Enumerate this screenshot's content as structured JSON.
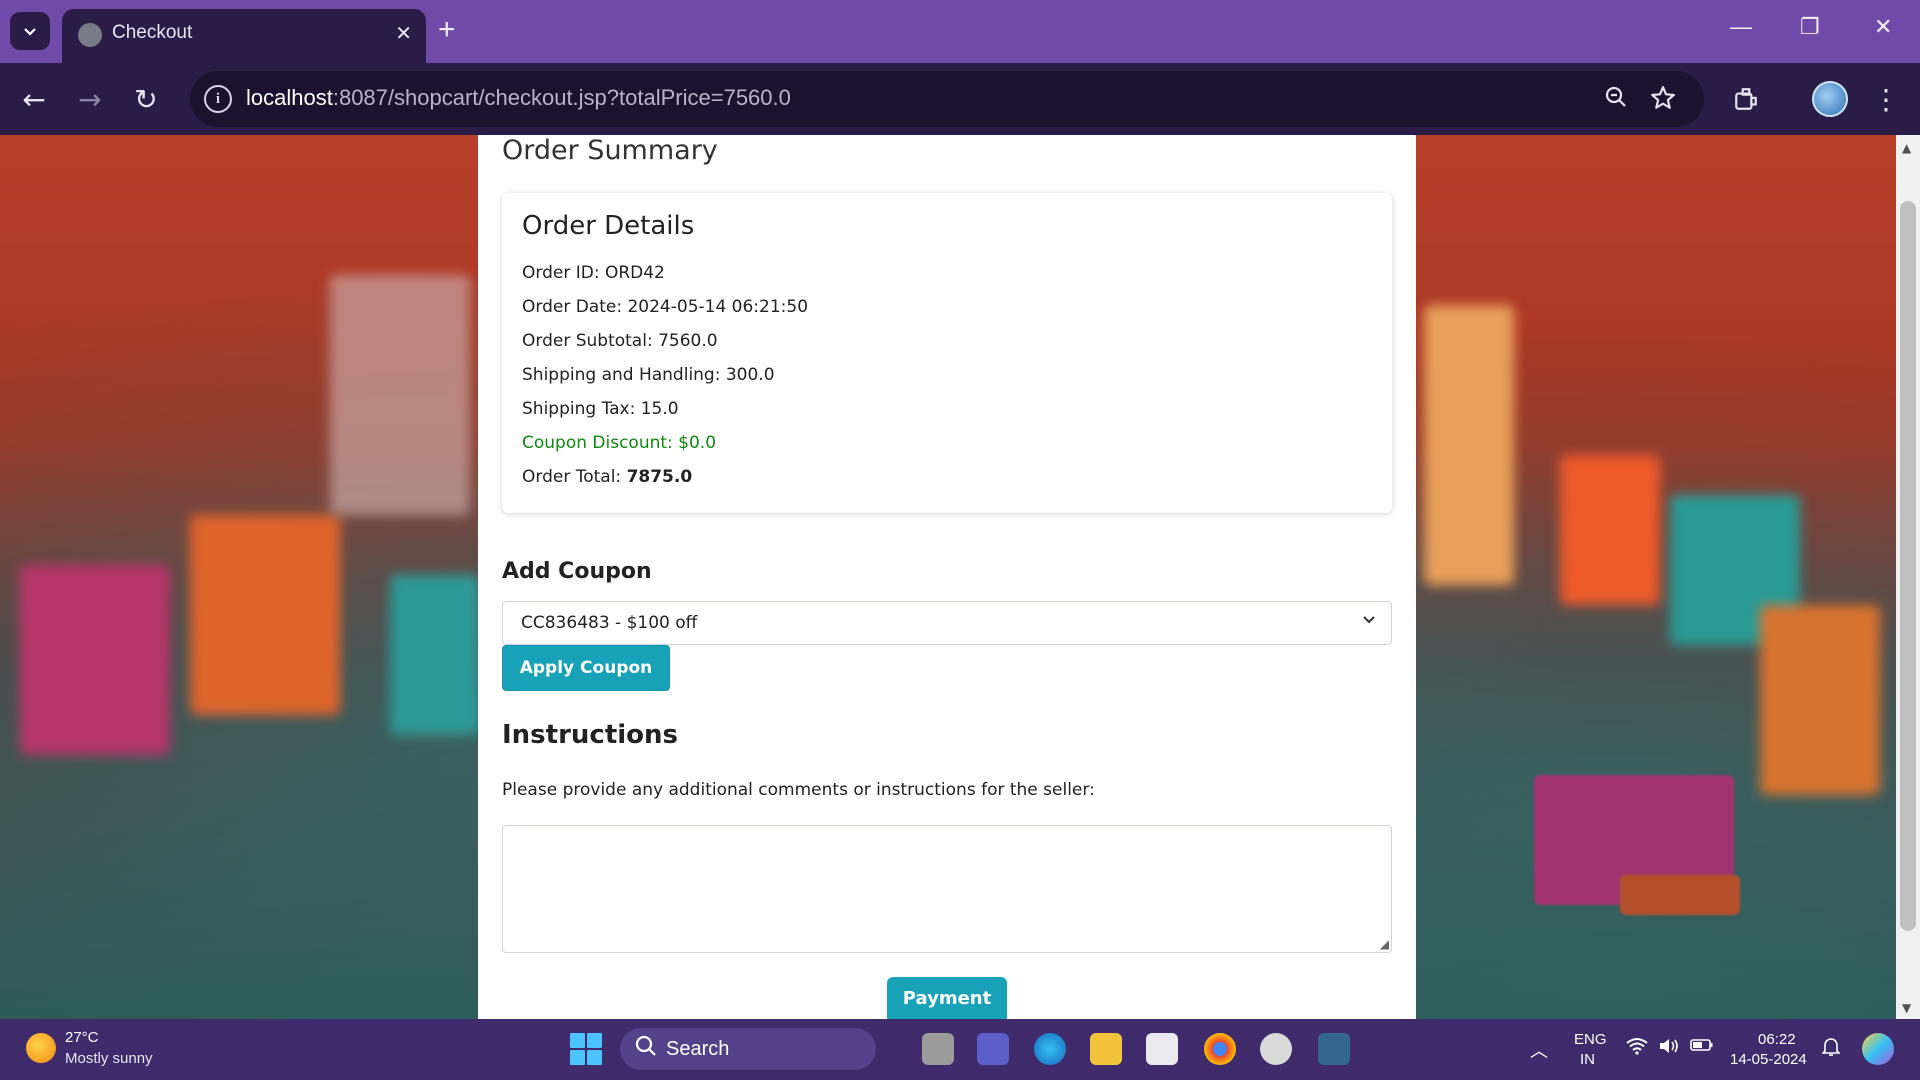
{
  "browser": {
    "tab_title": "Checkout",
    "tab_close": "✕",
    "new_tab": "+",
    "url_host": "localhost",
    "url_rest": ":8087/shopcart/checkout.jsp?totalPrice=7560.0",
    "window_controls": {
      "minimize": "—",
      "restore": "❐",
      "close": "✕"
    }
  },
  "page": {
    "summary_heading": "Order Summary",
    "details_heading": "Order Details",
    "order_id": "Order ID: ORD42",
    "order_date": "Order Date: 2024-05-14 06:21:50",
    "subtotal": "Order Subtotal: 7560.0",
    "shipping": "Shipping and Handling: 300.0",
    "shipping_tax": "Shipping Tax: 15.0",
    "coupon_discount": "Coupon Discount: $0.0",
    "order_total_label": "Order Total: ",
    "order_total_value": "7875.0",
    "coupon_heading": "Add Coupon",
    "coupon_selected": "CC836483 - $100 off",
    "apply_button": "Apply Coupon",
    "instructions_heading": "Instructions",
    "instructions_label": "Please provide any additional comments or instructions for the seller:",
    "payment_button": "Payment"
  },
  "taskbar": {
    "temperature": "27°C",
    "weather": "Mostly sunny",
    "search": "Search",
    "lang": "ENG",
    "region": "IN",
    "time": "06:22",
    "date": "14-05-2024"
  },
  "colors": {
    "accent_button": "#17a2b8",
    "coupon_discount": "#0f8a0f",
    "titlebar": "#6f4aa8"
  }
}
